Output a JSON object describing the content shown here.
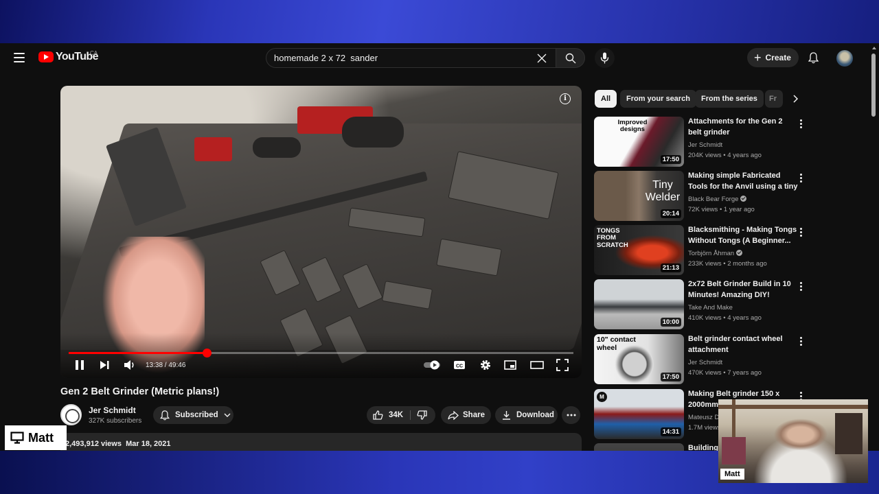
{
  "header": {
    "logo_text": "YouTube",
    "country_code": "CA",
    "search_value": "homemade 2 x 72  sander",
    "create_label": "Create"
  },
  "player": {
    "current_time": "13:38",
    "duration": "49:46",
    "time_display": "13:38 / 49:46",
    "progress_fraction": 0.274
  },
  "video": {
    "title": "Gen 2 Belt Grinder (Metric plans!)",
    "channel_name": "Jer Schmidt",
    "subscribers": "327K subscribers",
    "subscribed_label": "Subscribed",
    "likes": "34K",
    "share_label": "Share",
    "download_label": "Download",
    "views": "2,493,912 views",
    "date": "Mar 18, 2021"
  },
  "chips": [
    "All",
    "From your search",
    "From the series",
    "Fr"
  ],
  "recommendations": [
    {
      "title": "Attachments for the Gen 2 belt grinder",
      "channel": "Jer Schmidt",
      "verified": false,
      "views": "204K views",
      "age": "4 years ago",
      "duration": "17:50",
      "thumb_text": "Improved designs"
    },
    {
      "title": "Making simple Fabricated Tools for the Anvil using a tiny budg...",
      "channel": "Black Bear Forge",
      "verified": true,
      "views": "72K views",
      "age": "1 year ago",
      "duration": "20:14",
      "thumb_text": "Tiny Welder"
    },
    {
      "title": "Blacksmithing - Making Tongs Without Tongs (A Beginner...",
      "channel": "Torbjörn Åhman",
      "verified": true,
      "views": "233K views",
      "age": "2 months ago",
      "duration": "21:13",
      "thumb_text": "TONGS FROM SCRATCH"
    },
    {
      "title": "2x72 Belt Grinder Build in 10 Minutes! Amazing DIY!",
      "channel": "Take And Make",
      "verified": false,
      "views": "410K views",
      "age": "4 years ago",
      "duration": "10:00",
      "thumb_text": ""
    },
    {
      "title": "Belt grinder contact wheel attachment",
      "channel": "Jer Schmidt",
      "verified": false,
      "views": "470K views",
      "age": "7 years ago",
      "duration": "17:50",
      "thumb_text": "10\" contact wheel"
    },
    {
      "title": "Making Belt grinder 150 x 2000mm",
      "channel": "Mateusz D",
      "verified": false,
      "views": "1.7M views",
      "age": "",
      "duration": "14:31",
      "thumb_text": ""
    },
    {
      "title": "Building",
      "channel": "",
      "verified": false,
      "views": "",
      "age": "",
      "duration": "",
      "thumb_text": ""
    }
  ],
  "overlay": {
    "badge_name": "Matt",
    "webcam_label": "Matt"
  }
}
